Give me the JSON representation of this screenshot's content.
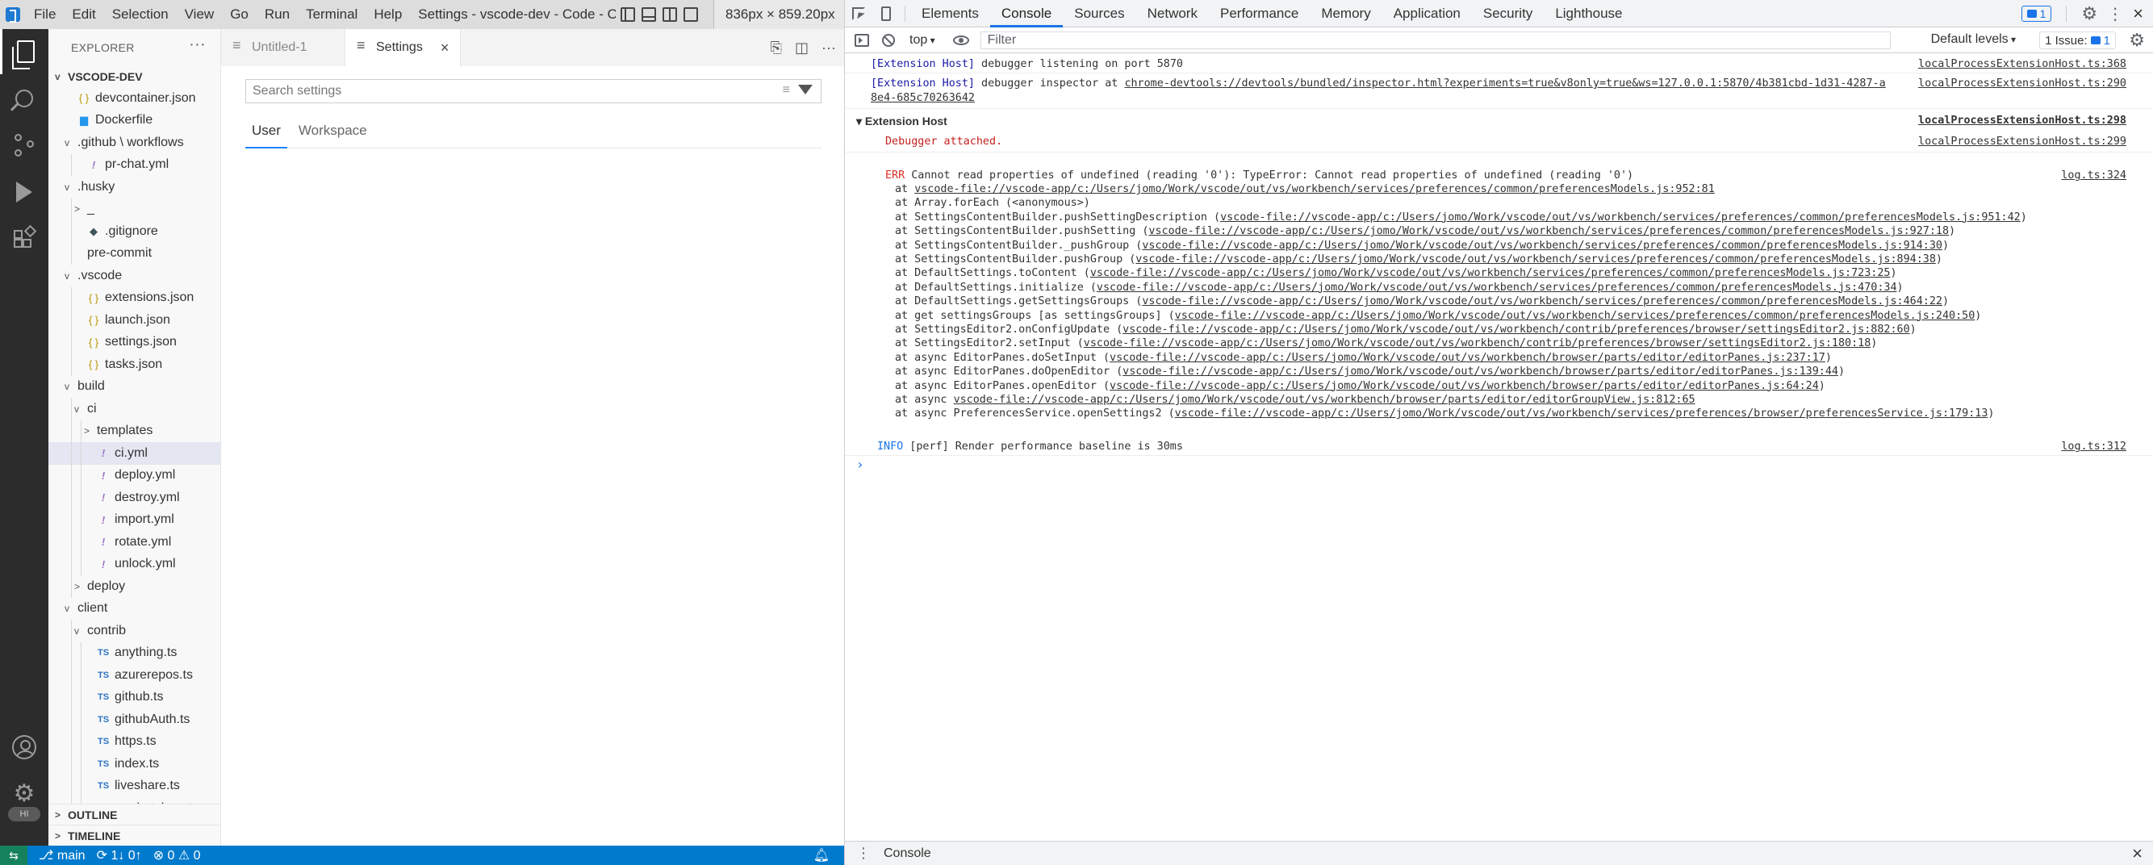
{
  "vscode": {
    "menu": [
      "File",
      "Edit",
      "Selection",
      "View",
      "Go",
      "Run",
      "Terminal",
      "Help"
    ],
    "window_title": "Settings - vscode-dev - Code - OSS...",
    "dimensions_tip": "836px × 859.20px",
    "activity_icons": [
      "files-icon",
      "search-icon",
      "source-control-icon",
      "run-debug-icon",
      "extensions-icon",
      "account-icon",
      "manage-gear-icon"
    ],
    "profile_badge": "HI",
    "explorer": {
      "header": "EXPLORER",
      "root": "VSCODE-DEV",
      "items": [
        {
          "label": "devcontainer.json",
          "icon": "json",
          "indent": 1,
          "twist": ""
        },
        {
          "label": "Dockerfile",
          "icon": "docker",
          "indent": 1,
          "twist": ""
        },
        {
          "label": ".github \\ workflows",
          "icon": "",
          "indent": 1,
          "twist": "v"
        },
        {
          "label": "pr-chat.yml",
          "icon": "yml",
          "indent": 2,
          "twist": ""
        },
        {
          "label": ".husky",
          "icon": "",
          "indent": 1,
          "twist": "v"
        },
        {
          "label": "_",
          "icon": "",
          "indent": 2,
          "twist": ">"
        },
        {
          "label": ".gitignore",
          "icon": "git",
          "indent": 2,
          "twist": ""
        },
        {
          "label": "pre-commit",
          "icon": "",
          "indent": 2,
          "twist": ""
        },
        {
          "label": ".vscode",
          "icon": "",
          "indent": 1,
          "twist": "v"
        },
        {
          "label": "extensions.json",
          "icon": "json",
          "indent": 2,
          "twist": ""
        },
        {
          "label": "launch.json",
          "icon": "json",
          "indent": 2,
          "twist": ""
        },
        {
          "label": "settings.json",
          "icon": "json",
          "indent": 2,
          "twist": ""
        },
        {
          "label": "tasks.json",
          "icon": "json",
          "indent": 2,
          "twist": ""
        },
        {
          "label": "build",
          "icon": "",
          "indent": 1,
          "twist": "v"
        },
        {
          "label": "ci",
          "icon": "",
          "indent": 2,
          "twist": "v"
        },
        {
          "label": "templates",
          "icon": "",
          "indent": 3,
          "twist": ">"
        },
        {
          "label": "ci.yml",
          "icon": "yml",
          "indent": 3,
          "twist": "",
          "selected": true
        },
        {
          "label": "deploy.yml",
          "icon": "yml",
          "indent": 3,
          "twist": ""
        },
        {
          "label": "destroy.yml",
          "icon": "yml",
          "indent": 3,
          "twist": ""
        },
        {
          "label": "import.yml",
          "icon": "yml",
          "indent": 3,
          "twist": ""
        },
        {
          "label": "rotate.yml",
          "icon": "yml",
          "indent": 3,
          "twist": ""
        },
        {
          "label": "unlock.yml",
          "icon": "yml",
          "indent": 3,
          "twist": ""
        },
        {
          "label": "deploy",
          "icon": "",
          "indent": 2,
          "twist": ">"
        },
        {
          "label": "client",
          "icon": "",
          "indent": 1,
          "twist": "v"
        },
        {
          "label": "contrib",
          "icon": "",
          "indent": 2,
          "twist": "v"
        },
        {
          "label": "anything.ts",
          "icon": "ts",
          "indent": 3,
          "twist": ""
        },
        {
          "label": "azurerepos.ts",
          "icon": "ts",
          "indent": 3,
          "twist": ""
        },
        {
          "label": "github.ts",
          "icon": "ts",
          "indent": 3,
          "twist": ""
        },
        {
          "label": "githubAuth.ts",
          "icon": "ts",
          "indent": 3,
          "twist": ""
        },
        {
          "label": "https.ts",
          "icon": "ts",
          "indent": 3,
          "twist": ""
        },
        {
          "label": "index.ts",
          "icon": "ts",
          "indent": 3,
          "twist": ""
        },
        {
          "label": "liveshare.ts",
          "icon": "ts",
          "indent": 3,
          "twist": ""
        },
        {
          "label": "marketplace.ts",
          "icon": "ts",
          "indent": 3,
          "twist": ""
        }
      ],
      "outline": "OUTLINE",
      "timeline": "TIMELINE"
    },
    "tabs": [
      {
        "label": "Untitled-1",
        "active": false
      },
      {
        "label": "Settings",
        "active": true
      }
    ],
    "settings": {
      "search_placeholder": "Search settings",
      "scope_tabs": [
        "User",
        "Workspace"
      ]
    },
    "statusbar": {
      "branch": "main",
      "sync": "1↓ 0↑",
      "problems": "⊗ 0 ⚠ 0"
    }
  },
  "devtools": {
    "tabs": [
      "Elements",
      "Console",
      "Sources",
      "Network",
      "Performance",
      "Memory",
      "Application",
      "Security",
      "Lighthouse"
    ],
    "active_tab": "Console",
    "message_count": "1",
    "toolbar": {
      "context": "top",
      "filter_placeholder": "Filter",
      "levels": "Default levels",
      "issues_label": "1 Issue:",
      "issues_count": "1"
    },
    "console": {
      "line1": {
        "tag": "[Extension Host]",
        "text": " debugger listening on port 5870",
        "src": "localProcessExtensionHost.ts:368"
      },
      "line2": {
        "tag": "[Extension Host]",
        "text": " debugger inspector at ",
        "link": "chrome-devtools://devtools/bundled/inspector.html?experiments=true&v8only=true&ws=127.0.0.1:5870/4b381cbd-1d31-4287-a",
        "link2": "8e4-685c70263642",
        "src": "localProcessExtensionHost.ts:290"
      },
      "group": {
        "label": "Extension Host",
        "src": "localProcessExtensionHost.ts:298"
      },
      "attached": {
        "text": "Debugger attached.",
        "src": "localProcessExtensionHost.ts:299"
      },
      "error": {
        "level": "ERR",
        "text": " Cannot read properties of undefined (reading '0'): TypeError: Cannot read properties of undefined (reading '0')",
        "src": "log.ts:324"
      },
      "stack": [
        {
          "pre": "at ",
          "link": "vscode-file://vscode-app/c:/Users/jomo/Work/vscode/out/vs/workbench/services/preferences/common/preferencesModels.js:952:81",
          "post": ""
        },
        {
          "pre": "at Array.forEach (<anonymous>)",
          "link": "",
          "post": ""
        },
        {
          "pre": "at SettingsContentBuilder.pushSettingDescription (",
          "link": "vscode-file://vscode-app/c:/Users/jomo/Work/vscode/out/vs/workbench/services/preferences/common/preferencesModels.js:951:42",
          "post": ")"
        },
        {
          "pre": "at SettingsContentBuilder.pushSetting (",
          "link": "vscode-file://vscode-app/c:/Users/jomo/Work/vscode/out/vs/workbench/services/preferences/common/preferencesModels.js:927:18",
          "post": ")"
        },
        {
          "pre": "at SettingsContentBuilder._pushGroup (",
          "link": "vscode-file://vscode-app/c:/Users/jomo/Work/vscode/out/vs/workbench/services/preferences/common/preferencesModels.js:914:30",
          "post": ")"
        },
        {
          "pre": "at SettingsContentBuilder.pushGroup (",
          "link": "vscode-file://vscode-app/c:/Users/jomo/Work/vscode/out/vs/workbench/services/preferences/common/preferencesModels.js:894:38",
          "post": ")"
        },
        {
          "pre": "at DefaultSettings.toContent (",
          "link": "vscode-file://vscode-app/c:/Users/jomo/Work/vscode/out/vs/workbench/services/preferences/common/preferencesModels.js:723:25",
          "post": ")"
        },
        {
          "pre": "at DefaultSettings.initialize (",
          "link": "vscode-file://vscode-app/c:/Users/jomo/Work/vscode/out/vs/workbench/services/preferences/common/preferencesModels.js:470:34",
          "post": ")"
        },
        {
          "pre": "at DefaultSettings.getSettingsGroups (",
          "link": "vscode-file://vscode-app/c:/Users/jomo/Work/vscode/out/vs/workbench/services/preferences/common/preferencesModels.js:464:22",
          "post": ")"
        },
        {
          "pre": "at get settingsGroups [as settingsGroups] (",
          "link": "vscode-file://vscode-app/c:/Users/jomo/Work/vscode/out/vs/workbench/services/preferences/common/preferencesModels.js:240:50",
          "post": ")"
        },
        {
          "pre": "at SettingsEditor2.onConfigUpdate (",
          "link": "vscode-file://vscode-app/c:/Users/jomo/Work/vscode/out/vs/workbench/contrib/preferences/browser/settingsEditor2.js:882:60",
          "post": ")"
        },
        {
          "pre": "at SettingsEditor2.setInput (",
          "link": "vscode-file://vscode-app/c:/Users/jomo/Work/vscode/out/vs/workbench/contrib/preferences/browser/settingsEditor2.js:180:18",
          "post": ")"
        },
        {
          "pre": "at async EditorPanes.doSetInput (",
          "link": "vscode-file://vscode-app/c:/Users/jomo/Work/vscode/out/vs/workbench/browser/parts/editor/editorPanes.js:237:17",
          "post": ")"
        },
        {
          "pre": "at async EditorPanes.doOpenEditor (",
          "link": "vscode-file://vscode-app/c:/Users/jomo/Work/vscode/out/vs/workbench/browser/parts/editor/editorPanes.js:139:44",
          "post": ")"
        },
        {
          "pre": "at async EditorPanes.openEditor (",
          "link": "vscode-file://vscode-app/c:/Users/jomo/Work/vscode/out/vs/workbench/browser/parts/editor/editorPanes.js:64:24",
          "post": ")"
        },
        {
          "pre": "at async ",
          "link": "vscode-file://vscode-app/c:/Users/jomo/Work/vscode/out/vs/workbench/browser/parts/editor/editorGroupView.js:812:65",
          "post": ""
        },
        {
          "pre": "at async PreferencesService.openSettings2 (",
          "link": "vscode-file://vscode-app/c:/Users/jomo/Work/vscode/out/vs/workbench/services/preferences/browser/preferencesService.js:179:13",
          "post": ")"
        }
      ],
      "info": {
        "level": "INFO",
        "text": " [perf] Render performance baseline is 30ms",
        "src": "log.ts:312"
      },
      "prompt": "›"
    },
    "drawer": {
      "label": "Console"
    }
  }
}
